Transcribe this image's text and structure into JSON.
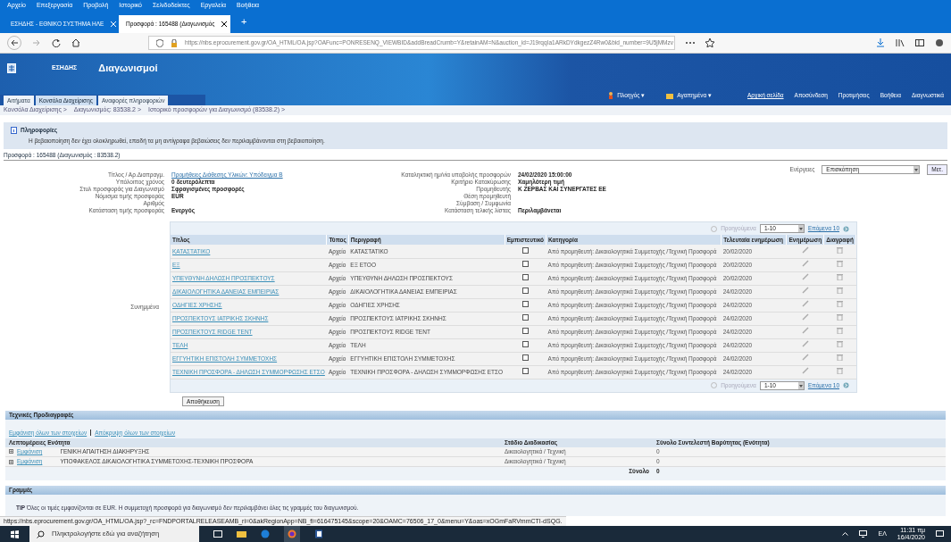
{
  "browser": {
    "menu": [
      "Αρχείο",
      "Επεξεργασία",
      "Προβολή",
      "Ιστορικό",
      "Σελιδοδείκτες",
      "Εργαλεία",
      "Βοήθεια"
    ],
    "tabs": [
      {
        "label": "ΕΣΗΔΗΣ - ΕΘΝΙΚΟ ΣΥΣΤΗΜΑ ΗΛΕ",
        "selected": false
      },
      {
        "label": "Προσφορά : 165488 (Διαγωνισμός",
        "selected": true
      }
    ],
    "new_tab": "+",
    "url": "https://nbs.eprocurement.gov.gr/OA_HTML/OA.jsp?OAFunc=PONRESENQ_VIEWBID&addBreadCrumb=Y&retainAM=N&auction_id=J19rqqIa1ARkDYdkgezZ4Rw0&bid_number=9U5jMMzv"
  },
  "header": {
    "logo": "ΕΣΗΔΗΣ",
    "title": "Διαγωνισμοί",
    "menus": [
      "Πλοηγός ▾",
      "Αγαπημένα ▾"
    ],
    "links": [
      "Αρχική σελίδα",
      "Αποσύνδεση",
      "Προτιμήσεις",
      "Βοήθεια",
      "Διαγνωστικά"
    ]
  },
  "tabs": [
    {
      "label": "Αιτήματα",
      "selected": false
    },
    {
      "label": "Κονσόλα Διαχείρισης",
      "selected": true
    },
    {
      "label": "Αναφορές πληροφοριών",
      "selected": false
    }
  ],
  "breadcrumbs": [
    "Κονσόλα Διαχείρισης >",
    "Διαγωνισμός: 83538.2 >",
    "Ιστορικό προσφορών για Διαγωνισμό (83538.2) >"
  ],
  "info": {
    "title": "Πληροφορίες",
    "message": "Η βεβαιοποίηση δεν έχει ολοκληρωθεί, επειδή τα μη αντίγραφα βεβαιώσεις δεν περιλαμβάνονται στη βεβαιοποίηση."
  },
  "page_title": "Προσφορά : 165488 (Διαγωνισμός : 83538.2)",
  "actions": {
    "label": "Ενέργειες",
    "value": "Επισκόπηση",
    "button": "Μετ."
  },
  "details_left": [
    {
      "label": "Τίτλος / Αρ.Διαπραγμ.",
      "value": "Προμήθειες Διάθεσης Υλικών: Υπόδειγμα Β",
      "kind": "link"
    },
    {
      "label": "Υπόλοιπος χρόνος",
      "value": "0 δευτερόλεπτα",
      "kind": "bold"
    },
    {
      "label": "Στυλ προσφοράς για Διαγωνισμό",
      "value": "Σφραγισμένες προσφορές",
      "kind": "bold"
    },
    {
      "label": "Νόμισμα τιμής προσφοράς",
      "value": "EUR",
      "kind": "bold"
    },
    {
      "label": "Αριθμός",
      "kind": "empty"
    },
    {
      "label": "Κατάσταση τιμής προσφοράς",
      "value": "Ενεργός",
      "kind": "bold"
    }
  ],
  "details_right": [
    {
      "label": "Καταληκτική ημ/νία υποβολής προσφορών",
      "value": "24/02/2020 15:00:00",
      "kind": "bold"
    },
    {
      "label": "Κριτήριο Κατακύρωσης",
      "value": "Χαμηλότερη τιμή",
      "kind": "bold"
    },
    {
      "label": "Προμηθευτής",
      "value": "Κ ΖΕΡΒΑΣ ΚΑΙ ΣΥΝΕΡΓΑΤΕΣ ΕΕ",
      "kind": "bold"
    },
    {
      "label": "Θέση προμηθευτή",
      "kind": "empty"
    },
    {
      "label": "Σύμβαση / Συμφωνία",
      "kind": "empty"
    },
    {
      "label": "Κατάσταση τελικής λίστας",
      "value": "Περιλαμβάνεται",
      "kind": "bold"
    }
  ],
  "attachments": {
    "label": "Συνημμένα",
    "pager_top": {
      "prev": "Προηγούμενα",
      "range": "1-10",
      "next": "Επόμενα 10"
    },
    "pager_bottom": {
      "prev": "Προηγούμενα",
      "range": "1-10",
      "next": "Επόμενα 10"
    },
    "columns": [
      "Τίτλος",
      "Τύπος",
      "Περιγραφή",
      "Εμπιστευτικό",
      "Κατηγορία",
      "Τελευταία ενημέρωση",
      "Ενημέρωση",
      "Διαγραφή"
    ],
    "rows": [
      {
        "title": "ΚΑΤΑΣΤΑΤΙΚΟ",
        "type": "Αρχείο",
        "description": "ΚΑΤΑΣΤΑΤΙΚΟ",
        "checked": false,
        "category": "Από προμηθευτή: Δικαιολογητικά Συμμετοχής /Τεχνική Προσφορά",
        "updated": "20/02/2020"
      },
      {
        "title": "ΕΞ",
        "type": "Αρχείο",
        "description": "ΕΞ ΕΤΟΟ",
        "checked": false,
        "category": "Από προμηθευτή: Δικαιολογητικά Συμμετοχής /Τεχνική Προσφορά",
        "updated": "20/02/2020"
      },
      {
        "title": "ΥΠΕΥΘΥΝΗ ΔΗΛΩΣΗ ΠΡΟΣΠΕΚΤΟΥΣ",
        "type": "Αρχείο",
        "description": "ΥΠΕΥΘΥΝΗ ΔΗΛΩΣΗ ΠΡΟΣΠΕΚΤΟΥΣ",
        "checked": false,
        "category": "Από προμηθευτή: Δικαιολογητικά Συμμετοχής /Τεχνική Προσφορά",
        "updated": "20/02/2020"
      },
      {
        "title": "ΔΙΚΑΙΟΛΟΓΗΤΙΚΑ ΔΑΝΕΙΑΣ ΕΜΠΕΙΡΙΑΣ",
        "type": "Αρχείο",
        "description": "ΔΙΚΑΙΟΛΟΓΗΤΙΚΑ ΔΑΝΕΙΑΣ ΕΜΠΕΙΡΙΑΣ",
        "checked": false,
        "category": "Από προμηθευτή: Δικαιολογητικά Συμμετοχής /Τεχνική Προσφορά",
        "updated": "24/02/2020"
      },
      {
        "title": "ΟΔΗΓΙΕΣ ΧΡΗΣΗΣ",
        "type": "Αρχείο",
        "description": "ΟΔΗΓΙΕΣ ΧΡΗΣΗΣ",
        "checked": false,
        "category": "Από προμηθευτή: Δικαιολογητικά Συμμετοχής /Τεχνική Προσφορά",
        "updated": "24/02/2020"
      },
      {
        "title": "ΠΡΟΣΠΕΚΤΟΥΣ ΙΑΤΡΙΚΗΣ ΣΚΗΝΗΣ",
        "type": "Αρχείο",
        "description": "ΠΡΟΣΠΕΚΤΟΥΣ ΙΑΤΡΙΚΗΣ ΣΚΗΝΗΣ",
        "checked": false,
        "category": "Από προμηθευτή: Δικαιολογητικά Συμμετοχής /Τεχνική Προσφορά",
        "updated": "24/02/2020"
      },
      {
        "title": "ΠΡΟΣΠΕΚΤΟΥΣ RIDGE TENT",
        "type": "Αρχείο",
        "description": "ΠΡΟΣΠΕΚΤΟΥΣ RIDGE TENT",
        "checked": false,
        "category": "Από προμηθευτή: Δικαιολογητικά Συμμετοχής /Τεχνική Προσφορά",
        "updated": "24/02/2020"
      },
      {
        "title": "ΤΕΛΗ",
        "type": "Αρχείο",
        "description": "ΤΕΛΗ",
        "checked": false,
        "category": "Από προμηθευτή: Δικαιολογητικά Συμμετοχής /Τεχνική Προσφορά",
        "updated": "24/02/2020"
      },
      {
        "title": "ΕΓΓΥΗΤΙΚΗ ΕΠΙΣΤΟΛΗ ΣΥΜΜΕΤΟΧΗΣ",
        "type": "Αρχείο",
        "description": "ΕΓΓΥΗΤΙΚΗ ΕΠΙΣΤΟΛΗ ΣΥΜΜΕΤΟΧΗΣ",
        "checked": false,
        "category": "Από προμηθευτή: Δικαιολογητικά Συμμετοχής /Τεχνική Προσφορά",
        "updated": "24/02/2020"
      },
      {
        "title": "ΤΕΧΝΙΚΗ ΠΡΟΣΦΟΡΑ - ΔΗΛΩΣΗ ΣΥΜΜΟΡΦΩΣΗΣ ΕΤΣΟ",
        "type": "Αρχείο",
        "description": "ΤΕΧΝΙΚΗ ΠΡΟΣΦΟΡΑ - ΔΗΛΩΣΗ ΣΥΜΜΟΡΦΩΣΗΣ ΕΤΣΟ",
        "checked": false,
        "category": "Από προμηθευτή: Δικαιολογητικά Συμμετοχής /Τεχνική Προσφορά",
        "updated": "24/02/2020"
      }
    ]
  },
  "save_button": "Αποθήκευση",
  "specs": {
    "title": "Τεχνικές Προδιαγραφές",
    "show_all": "Εμφάνιση όλων των στοιχείων",
    "hide_all": "Απόκρυψη όλων των στοιχείων",
    "columns": [
      "Λεπτομέρειες Ενότητα",
      "Στάδιο Διαδικασίας",
      "Σύνολο Συντελεστή Βαρύτητας (Ενότητα)"
    ],
    "rows": [
      {
        "action": "Εμφάνιση",
        "name": "ΓΕΝΙΚΗ ΑΠΑΙΤΗΣΗ ΔΙΑΚΗΡΥΞΗΣ",
        "stage": "Δικαιολογητικά / Τεχνική",
        "weight": "0"
      },
      {
        "action": "Εμφάνιση",
        "name": "ΥΠΟΦΑΚΕΛΟΣ ΔΙΚΑΙΟΛΟΓΗΤΙΚΑ ΣΥΜΜΕΤΟΧΗΣ-ΤΕΧΝΙΚΗ ΠΡΟΣΦΟΡΑ",
        "stage": "Δικαιολογητικά / Τεχνική",
        "weight": "0"
      }
    ],
    "total_label": "Σύνολο",
    "total": "0"
  },
  "lines": {
    "title": "Γραμμές",
    "tip": "**TIP** Όλες οι τιμές εμφανίζονται σε EUR. Η συμμετοχή προσφορά για διαγωνισμό δεν περιλαμβάνει όλες τις γραμμές του διαγωνισμού."
  },
  "status_url": "https://nbs.eprocurement.gov.gr/OA_HTML/OA.jsp?_rc=FNDPORTALRELEASEAMB_ri=0&akRegionApp=NB_fi=616475145&scope=20&OAMC=76506_17_0&menu=Y&oas=xOGmFaRVmmCTI-dSQG.",
  "taskbar": {
    "search": "Πληκτρολογήστε εδώ για αναζήτηση",
    "language": "ΕΛ",
    "time": "11:31 πμ",
    "date": "16/4/2020"
  }
}
